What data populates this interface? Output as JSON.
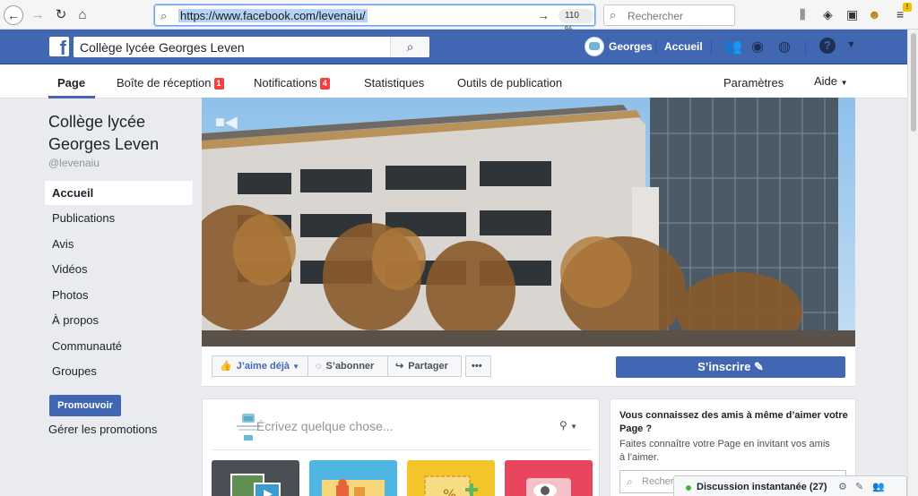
{
  "browser": {
    "url": "https://www.facebook.com/levenaiu/",
    "zoom": "110 %",
    "search_placeholder": "Rechercher",
    "notification_count": "!"
  },
  "fb_header": {
    "search_value": "Collège lycée Georges Leven",
    "user_name": "Georges",
    "home_label": "Accueil"
  },
  "tabs": {
    "page": "Page",
    "inbox": "Boîte de réception",
    "inbox_badge": "1",
    "notifications": "Notifications",
    "notifications_badge": "4",
    "stats": "Statistiques",
    "tools": "Outils de publication",
    "settings": "Paramètres",
    "help": "Aide"
  },
  "sidebar": {
    "page_name": "Collège lycée Georges Leven",
    "handle": "@levenaiu",
    "items": [
      {
        "label": "Accueil"
      },
      {
        "label": "Publications"
      },
      {
        "label": "Avis"
      },
      {
        "label": "Vidéos"
      },
      {
        "label": "Photos"
      },
      {
        "label": "À propos"
      },
      {
        "label": "Communauté"
      },
      {
        "label": "Groupes"
      }
    ],
    "promote_label": "Promouvoir",
    "manage_promotions": "Gérer les promotions"
  },
  "cover_actions": {
    "like": "J’aime déjà",
    "follow": "S’abonner",
    "share": "Partager",
    "more": "•••",
    "signup": "S’inscrire"
  },
  "composer": {
    "placeholder": "Écrivez quelque chose..."
  },
  "friends_card": {
    "title": "Vous connaissez des amis à même d’aimer votre Page ?",
    "description": "Faites connaître votre Page en invitant vos amis à l’aimer.",
    "search_placeholder": "Rechercher"
  },
  "chat": {
    "label": "Discussion instantanée (27)"
  }
}
